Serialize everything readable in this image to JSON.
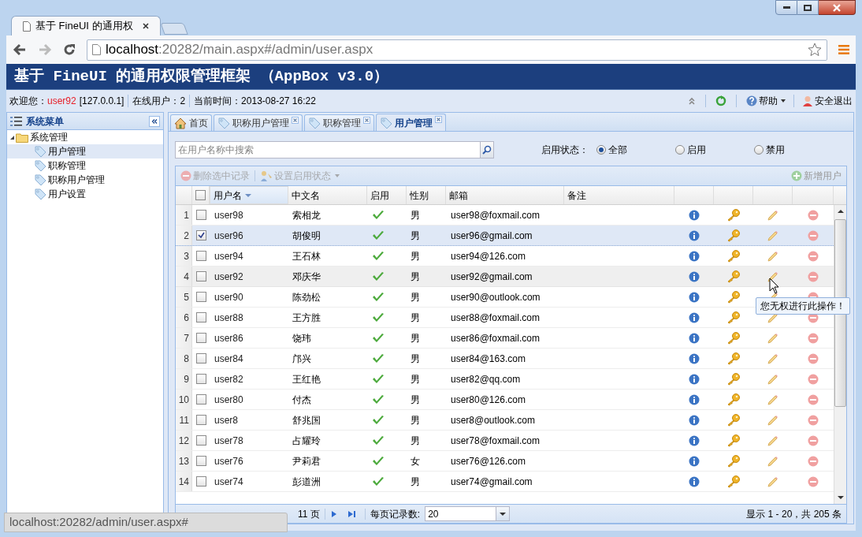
{
  "browser": {
    "tab_title": "基于 FineUI 的通用权",
    "url_host": "localhost",
    "url_rest": ":20282/main.aspx#/admin/user.aspx",
    "status_url": "localhost:20282/admin/user.aspx#"
  },
  "app_title": "基于 FineUI 的通用权限管理框架 （AppBox v3.0）",
  "info": {
    "welcome": "欢迎您：",
    "user": "user92",
    "ip": "[127.0.0.1]",
    "online": "在线用户：2",
    "time": "当前时间：2013-08-27 16:22",
    "help": "帮助",
    "logout": "安全退出"
  },
  "sidebar": {
    "title": "系统菜单",
    "tree": [
      {
        "label": "系统管理",
        "expanded": true,
        "children": [
          {
            "label": "用户管理",
            "selected": true
          },
          {
            "label": "职称管理",
            "selected": false
          },
          {
            "label": "职称用户管理",
            "selected": false
          },
          {
            "label": "用户设置",
            "selected": false
          }
        ]
      }
    ]
  },
  "tabs": [
    {
      "label": "首页",
      "kind": "home",
      "selected": false
    },
    {
      "label": "职称用户管理",
      "kind": "closable",
      "selected": false
    },
    {
      "label": "职称管理",
      "kind": "closable",
      "selected": false
    },
    {
      "label": "用户管理",
      "kind": "closable",
      "selected": true
    }
  ],
  "search": {
    "placeholder": "在用户名称中搜索"
  },
  "filter": {
    "label": "启用状态：",
    "options": [
      {
        "label": "全部",
        "selected": true
      },
      {
        "label": "启用",
        "selected": false
      },
      {
        "label": "禁用",
        "selected": false
      }
    ]
  },
  "toolbar": {
    "delete": {
      "label": "删除选中记录",
      "disabled": true
    },
    "set_status": {
      "label": "设置启用状态",
      "disabled": true
    },
    "add": {
      "label": "新增用户",
      "disabled": true
    }
  },
  "select_all": {
    "checked": false
  },
  "columns": [
    "用户名",
    "中文名",
    "启用",
    "性别",
    "邮箱",
    "备注"
  ],
  "rows": [
    {
      "index": "1",
      "checked": false,
      "hovered": false,
      "username": "user98",
      "name": "索相龙",
      "enabled": true,
      "gender": "男",
      "email": "user98@foxmail.com"
    },
    {
      "index": "2",
      "checked": true,
      "hovered": false,
      "username": "user96",
      "name": "胡俊明",
      "enabled": true,
      "gender": "男",
      "email": "user96@gmail.com"
    },
    {
      "index": "3",
      "checked": false,
      "hovered": false,
      "username": "user94",
      "name": "王石林",
      "enabled": true,
      "gender": "男",
      "email": "user94@126.com"
    },
    {
      "index": "4",
      "checked": false,
      "hovered": true,
      "username": "user92",
      "name": "邓庆华",
      "enabled": true,
      "gender": "男",
      "email": "user92@gmail.com"
    },
    {
      "index": "5",
      "checked": false,
      "hovered": false,
      "username": "user90",
      "name": "陈劲松",
      "enabled": true,
      "gender": "男",
      "email": "user90@outlook.com"
    },
    {
      "index": "6",
      "checked": false,
      "hovered": false,
      "username": "user88",
      "name": "王方胜",
      "enabled": true,
      "gender": "男",
      "email": "user88@foxmail.com"
    },
    {
      "index": "7",
      "checked": false,
      "hovered": false,
      "username": "user86",
      "name": "饶玮",
      "enabled": true,
      "gender": "男",
      "email": "user86@foxmail.com"
    },
    {
      "index": "8",
      "checked": false,
      "hovered": false,
      "username": "user84",
      "name": "邝兴",
      "enabled": true,
      "gender": "男",
      "email": "user84@163.com"
    },
    {
      "index": "9",
      "checked": false,
      "hovered": false,
      "username": "user82",
      "name": "王红艳",
      "enabled": true,
      "gender": "男",
      "email": "user82@qq.com"
    },
    {
      "index": "10",
      "checked": false,
      "hovered": false,
      "username": "user80",
      "name": "付杰",
      "enabled": true,
      "gender": "男",
      "email": "user80@126.com"
    },
    {
      "index": "11",
      "checked": false,
      "hovered": false,
      "username": "user8",
      "name": "舒兆国",
      "enabled": true,
      "gender": "男",
      "email": "user8@outlook.com"
    },
    {
      "index": "12",
      "checked": false,
      "hovered": false,
      "username": "user78",
      "name": "占耀玲",
      "enabled": true,
      "gender": "男",
      "email": "user78@foxmail.com"
    },
    {
      "index": "13",
      "checked": false,
      "hovered": false,
      "username": "user76",
      "name": "尹莉君",
      "enabled": true,
      "gender": "女",
      "email": "user76@126.com"
    },
    {
      "index": "14",
      "checked": false,
      "hovered": false,
      "username": "user74",
      "name": "彭道洲",
      "enabled": true,
      "gender": "男",
      "email": "user74@gmail.com"
    }
  ],
  "pager": {
    "pages": "11 页",
    "page_size_label": "每页记录数:",
    "page_size": "20",
    "summary": "显示 1 - 20，共 205 条"
  },
  "tooltip": "您无权进行此操作！"
}
